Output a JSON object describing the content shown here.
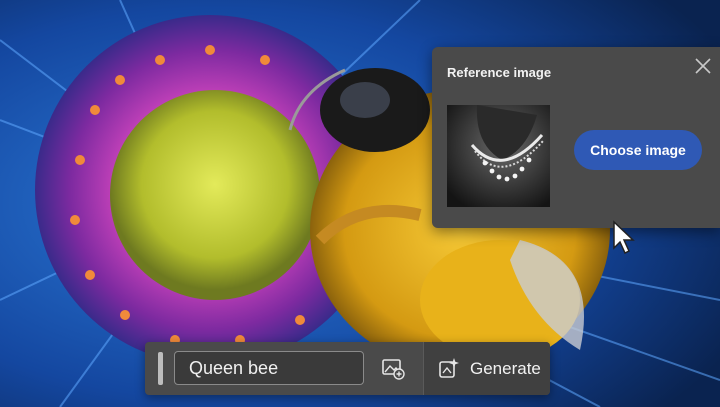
{
  "reference_panel": {
    "title": "Reference image",
    "choose_label": "Choose image"
  },
  "prompt_bar": {
    "prompt_value": "Queen bee",
    "generate_label": "Generate"
  },
  "colors": {
    "panel_bg": "#4a4a4a",
    "accent_button": "#2f59b5",
    "petal_blue": "#1f5fc0",
    "flower_magenta": "#9b2fa8",
    "flower_center": "#c7d43a",
    "bee_yellow": "#e8b21a"
  },
  "icons": [
    "close-icon",
    "image-add-icon",
    "sparkle-generate-icon",
    "mouse-pointer-icon"
  ]
}
